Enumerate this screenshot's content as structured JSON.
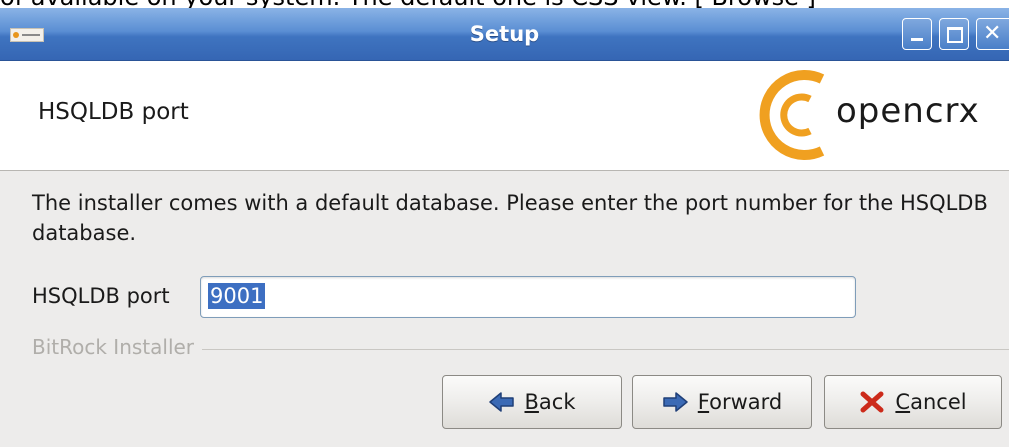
{
  "background_window": {
    "clipped_text": "of available on your system. The default one is CSS view. [ Browse ]"
  },
  "window": {
    "title": "Setup"
  },
  "header": {
    "title": "HSQLDB port",
    "logo_text": "opencrx"
  },
  "body": {
    "description": "The installer comes with a default database. Please enter the port number for the HSQLDB database.",
    "port_label": "HSQLDB port",
    "port_value": "9001",
    "installer_brand": "BitRock Installer"
  },
  "buttons": {
    "back": {
      "mnemonic": "B",
      "rest": "ack"
    },
    "forward": {
      "mnemonic": "F",
      "rest": "orward"
    },
    "cancel": {
      "mnemonic": "C",
      "rest": "ancel"
    }
  },
  "colors": {
    "titlebar": "#4a7fc8",
    "logo_accent": "#f0a020",
    "selection": "#3d6fc2",
    "cancel_icon": "#cc2a1a"
  },
  "icons": {
    "back": "left-arrow-icon",
    "forward": "right-arrow-icon",
    "cancel": "red-x-icon",
    "window_close": "close-icon"
  }
}
